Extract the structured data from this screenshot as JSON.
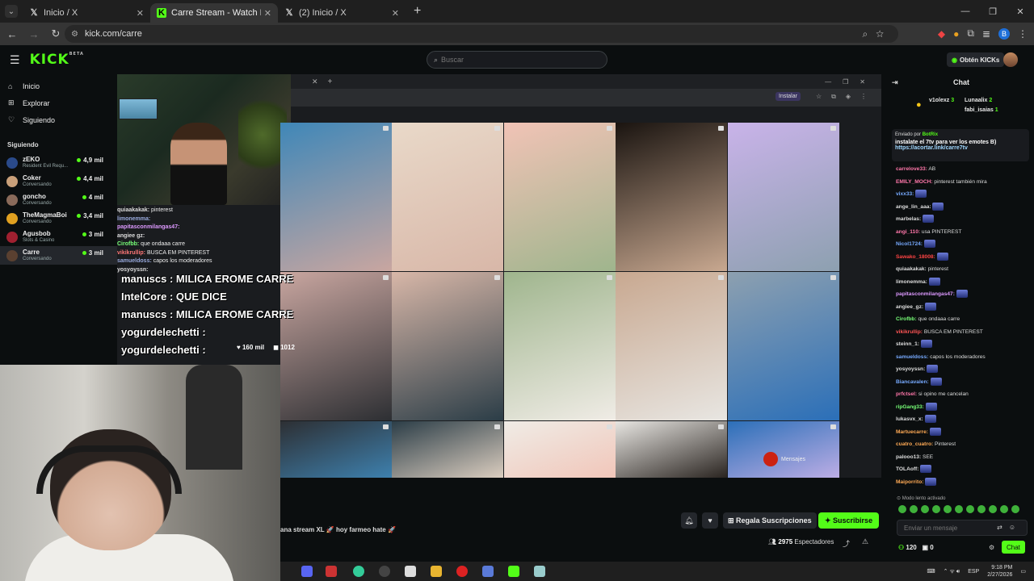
{
  "browser": {
    "tabs": [
      {
        "title": "Inicio / X",
        "favicon": "x-logo"
      },
      {
        "title": "Carre Stream - Watch Live on K",
        "favicon": "kick-logo"
      },
      {
        "title": "(2) Inicio / X",
        "favicon": "x-logo"
      }
    ],
    "url": "kick.com/carre",
    "profile_initial": "B"
  },
  "header": {
    "logo": "KICK",
    "logo_sup": "BETA",
    "search_placeholder": "Buscar",
    "kicks_button": "Obtén KICKs"
  },
  "sidebar": {
    "nav": [
      {
        "label": "Inicio",
        "icon": "home-icon"
      },
      {
        "label": "Explorar",
        "icon": "compass-icon"
      },
      {
        "label": "Siguiendo",
        "icon": "heart-icon"
      }
    ],
    "section_title": "Siguiendo",
    "following": [
      {
        "name": "zEKO",
        "category": "Resident Evil Requ...",
        "viewers": "4,9 mil",
        "color": "#2a4a8a"
      },
      {
        "name": "Coker",
        "category": "Conversando",
        "viewers": "4,4 mil",
        "color": "#c9a07a"
      },
      {
        "name": "goncho",
        "category": "Conversando",
        "viewers": "4 mil",
        "color": "#8a6a5a"
      },
      {
        "name": "TheMagmaBoi",
        "category": "Conversando",
        "viewers": "3,4 mil",
        "color": "#e0a020"
      },
      {
        "name": "Agusbob",
        "category": "Slots & Casino",
        "viewers": "3 mil",
        "color": "#a02030"
      },
      {
        "name": "Carre",
        "category": "Conversando",
        "viewers": "3 mil",
        "color": "#5a4030"
      }
    ]
  },
  "stream_overlay": {
    "chat_lines": [
      {
        "user": "quiaakakak:",
        "text": "pinterest",
        "color": "#ddd"
      },
      {
        "user": "limonemma:",
        "text": "",
        "color": "#9ad"
      },
      {
        "user": "papitasconmilangas47:",
        "text": "",
        "color": "#d9f"
      },
      {
        "user": "angiee gz:",
        "text": "",
        "color": "#ddd"
      },
      {
        "user": "Cirofbb:",
        "text": "que ondaaa carre",
        "color": "#7f7"
      },
      {
        "user": "vikikrullip:",
        "text": "BUSCA EM PINTEREST",
        "color": "#f77"
      },
      {
        "user": "samueldoss:",
        "text": "capos los moderadores",
        "color": "#9ad"
      },
      {
        "user": "yosyoyssn:",
        "text": "",
        "color": "#ddd"
      }
    ],
    "big_messages": [
      "manuscs : MILICA EROME CARRE",
      "IntelCore : QUE DICE",
      "manuscs : MILICA EROME CARRE",
      "yogurdelechetti :",
      "yogurdelechetti :"
    ],
    "likes": "160 mil",
    "comments": "1012",
    "messages_label": "Mensajes",
    "instalar": "Instalar"
  },
  "below_stream": {
    "title": "ana stream XL 🚀 hoy farmeo hate 🚀",
    "gift_button": "Regala Suscripciones",
    "subscribe_button": "Suscribirse",
    "viewers_count": "2975",
    "viewers_label": "Espectadores"
  },
  "chat": {
    "header": "Chat",
    "top_gifters": [
      {
        "name": "v1olexz",
        "count": "3"
      },
      {
        "name": "Lunaalix",
        "count": "2"
      },
      {
        "name": "fabi_isaias",
        "count": "1"
      }
    ],
    "pinned": {
      "by_label": "Enviado por",
      "by_user": "BotRix",
      "text": "instalate el 7tv para ver los emotes B)",
      "link": "https://acortar.link/carre7tv"
    },
    "messages": [
      {
        "user": "carrelove33:",
        "text": "AB",
        "color": "#f7a"
      },
      {
        "user": "EMILY_MOCH:",
        "text": "pinterest también mira",
        "color": "#f7a"
      },
      {
        "user": "vixx33:",
        "text": "",
        "color": "#7af"
      },
      {
        "user": "ange_lin_aaa:",
        "text": "",
        "color": "#ddd"
      },
      {
        "user": "marbelas:",
        "text": "",
        "color": "#ddd"
      },
      {
        "user": "angi_110:",
        "text": "usa PINTEREST",
        "color": "#f7a"
      },
      {
        "user": "Nicol1724:",
        "text": "",
        "color": "#7af"
      },
      {
        "user": "Sawako_18008:",
        "text": "",
        "color": "#f44"
      },
      {
        "user": "quiaakakak:",
        "text": "pinterest",
        "color": "#ddd"
      },
      {
        "user": "limonemma:",
        "text": "",
        "color": "#ddd"
      },
      {
        "user": "papitasconmilangas47:",
        "text": "",
        "color": "#d9f"
      },
      {
        "user": "angiee_gz:",
        "text": "",
        "color": "#ddd"
      },
      {
        "user": "Cirofbb:",
        "text": "que ondaaa carre",
        "color": "#7f7"
      },
      {
        "user": "vikikrullip:",
        "text": "BUSCA EM PINTEREST",
        "color": "#f55"
      },
      {
        "user": "steinn_1:",
        "text": "",
        "color": "#ddd"
      },
      {
        "user": "samueldoss:",
        "text": "capos los moderadores",
        "color": "#7af"
      },
      {
        "user": "yosyoyssn:",
        "text": "",
        "color": "#ddd"
      },
      {
        "user": "Biancavalen:",
        "text": "",
        "color": "#7af"
      },
      {
        "user": "prfctsel:",
        "text": "si opino me cancelan",
        "color": "#f7a"
      },
      {
        "user": "ripGang33:",
        "text": "",
        "color": "#7f7"
      },
      {
        "user": "lukasvx_x:",
        "text": "",
        "color": "#ddd"
      },
      {
        "user": "Martuecarre:",
        "text": "",
        "color": "#fa5"
      },
      {
        "user": "cuatro_cuatro:",
        "text": "Pinterest",
        "color": "#fa5"
      },
      {
        "user": "palooo13:",
        "text": "SEE",
        "color": "#ddd"
      },
      {
        "user": "TOLAoff:",
        "text": "",
        "color": "#ddd"
      },
      {
        "user": "Maiporrito:",
        "text": "",
        "color": "#fa5"
      }
    ],
    "slow_mode": "Modo lento activado",
    "input_placeholder": "Enviar un mensaje",
    "points": "120",
    "subs": "0",
    "chat_button": "Chat"
  },
  "os": {
    "lang": "ESP",
    "time": "9:18 PM",
    "date": "2/27/2026"
  }
}
